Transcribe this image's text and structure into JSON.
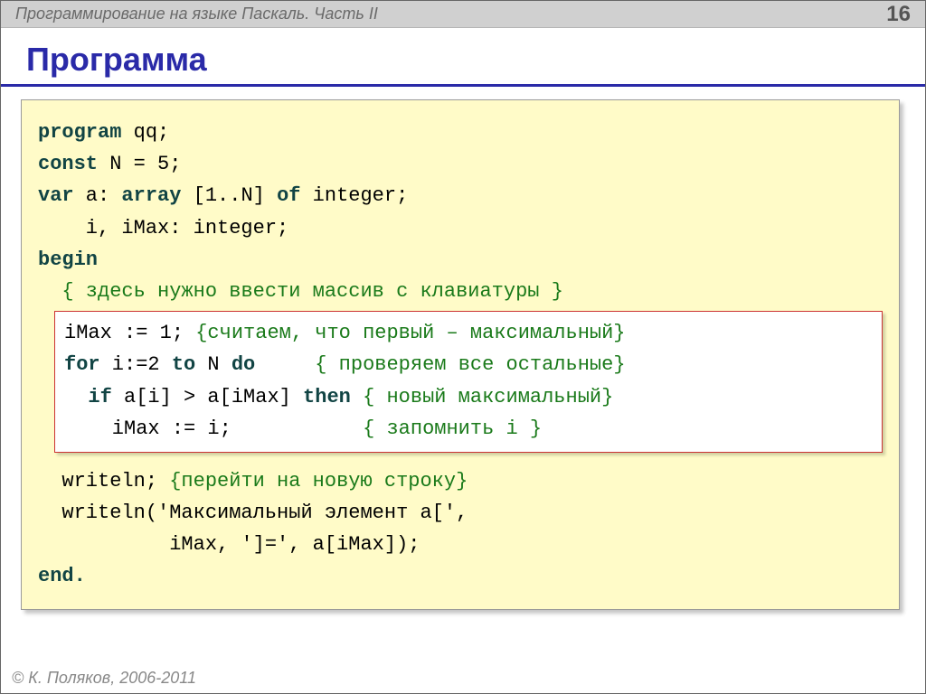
{
  "header": {
    "title": "Программирование на языке Паскаль. Часть II",
    "page_number": "16"
  },
  "heading": "Программа",
  "code": {
    "l1_a": "program",
    "l1_b": " qq;",
    "l2_a": "const",
    "l2_b": " N = 5;",
    "l3_a": "var",
    "l3_b": " a: ",
    "l3_c": "array",
    "l3_d": " [1..N] ",
    "l3_e": "of",
    "l3_f": " integer;",
    "l4": "    i, iMax: integer;",
    "l5": "begin",
    "l6_indent": "  ",
    "l6_cmt": "{ здесь нужно ввести массив с клавиатуры }",
    "h1_a": "iMax := 1; ",
    "h1_cmt": "{считаем, что первый – максимальный}",
    "h2_a": "for",
    "h2_b": " i:=2 ",
    "h2_c": "to",
    "h2_d": " N ",
    "h2_e": "do",
    "h2_f": "     ",
    "h2_cmt": "{ проверяем все остальные}",
    "h3_a": "  ",
    "h3_b": "if",
    "h3_c": " a[i] > a[iMax] ",
    "h3_d": "then",
    "h3_e": " ",
    "h3_cmt": "{ новый максимальный}",
    "h4_a": "    iMax := i;           ",
    "h4_cmt": "{ запомнить i }",
    "l7_a": "  writeln; ",
    "l7_cmt": "{перейти на новую строку}",
    "l8": "  writeln('Максимальный элемент a[',",
    "l9": "           iMax, ']=', a[iMax]);",
    "l10": "end."
  },
  "footer": "© К. Поляков, 2006-2011"
}
